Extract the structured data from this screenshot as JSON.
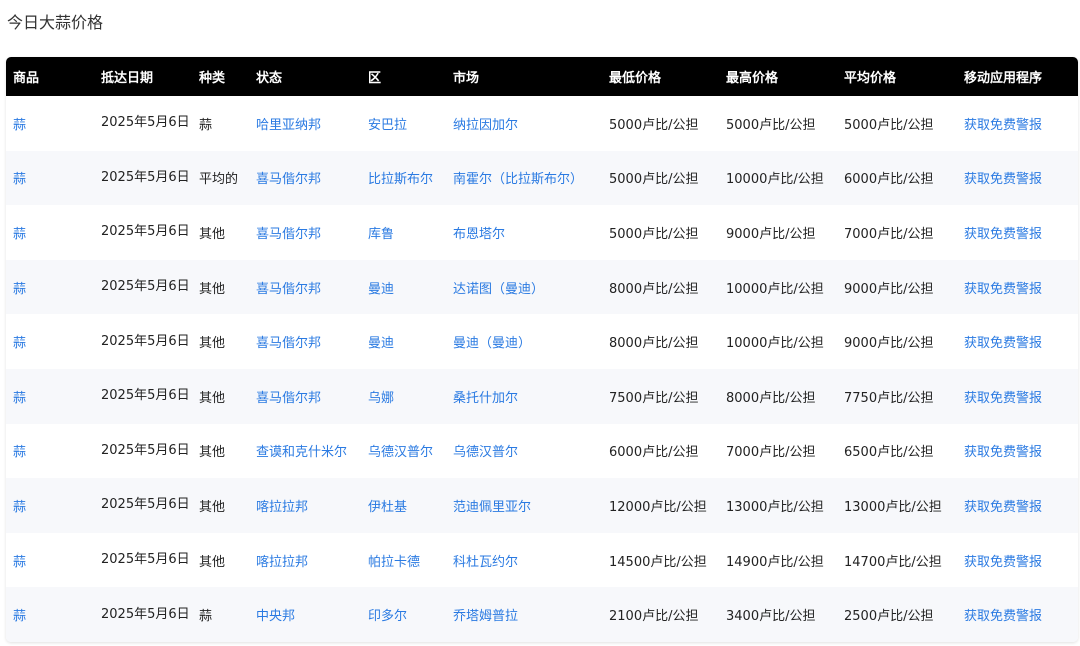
{
  "page": {
    "title": "今日大蒜价格"
  },
  "table": {
    "headers": [
      "商品",
      "抵达日期",
      "种类",
      "状态",
      "区",
      "市场",
      "最低价格",
      "最高价格",
      "平均价格",
      "移动应用程序"
    ],
    "rows": [
      {
        "commodity": "蒜",
        "date": "2025年5月6日",
        "variety": "蒜",
        "state": "哈里亚纳邦",
        "district": "安巴拉",
        "market": "纳拉因加尔",
        "min": "5000卢比/公担",
        "max": "5000卢比/公担",
        "avg": "5000卢比/公担",
        "app": "获取免费警报"
      },
      {
        "commodity": "蒜",
        "date": "2025年5月6日",
        "variety": "平均的",
        "state": "喜马偕尔邦",
        "district": "比拉斯布尔",
        "market": "南霍尔（比拉斯布尔）",
        "min": "5000卢比/公担",
        "max": "10000卢比/公担",
        "avg": "6000卢比/公担",
        "app": "获取免费警报"
      },
      {
        "commodity": "蒜",
        "date": "2025年5月6日",
        "variety": "其他",
        "state": "喜马偕尔邦",
        "district": "库鲁",
        "market": "布恩塔尔",
        "min": "5000卢比/公担",
        "max": "9000卢比/公担",
        "avg": "7000卢比/公担",
        "app": "获取免费警报"
      },
      {
        "commodity": "蒜",
        "date": "2025年5月6日",
        "variety": "其他",
        "state": "喜马偕尔邦",
        "district": "曼迪",
        "market": "达诺图（曼迪）",
        "min": "8000卢比/公担",
        "max": "10000卢比/公担",
        "avg": "9000卢比/公担",
        "app": "获取免费警报"
      },
      {
        "commodity": "蒜",
        "date": "2025年5月6日",
        "variety": "其他",
        "state": "喜马偕尔邦",
        "district": "曼迪",
        "market": "曼迪（曼迪）",
        "min": "8000卢比/公担",
        "max": "10000卢比/公担",
        "avg": "9000卢比/公担",
        "app": "获取免费警报"
      },
      {
        "commodity": "蒜",
        "date": "2025年5月6日",
        "variety": "其他",
        "state": "喜马偕尔邦",
        "district": "乌娜",
        "market": "桑托什加尔",
        "min": "7500卢比/公担",
        "max": "8000卢比/公担",
        "avg": "7750卢比/公担",
        "app": "获取免费警报"
      },
      {
        "commodity": "蒜",
        "date": "2025年5月6日",
        "variety": "其他",
        "state": "查谟和克什米尔",
        "district": "乌德汉普尔",
        "market": "乌德汉普尔",
        "min": "6000卢比/公担",
        "max": "7000卢比/公担",
        "avg": "6500卢比/公担",
        "app": "获取免费警报"
      },
      {
        "commodity": "蒜",
        "date": "2025年5月6日",
        "variety": "其他",
        "state": "喀拉拉邦",
        "district": "伊杜基",
        "market": "范迪佩里亚尔",
        "min": "12000卢比/公担",
        "max": "13000卢比/公担",
        "avg": "13000卢比/公担",
        "app": "获取免费警报"
      },
      {
        "commodity": "蒜",
        "date": "2025年5月6日",
        "variety": "其他",
        "state": "喀拉拉邦",
        "district": "帕拉卡德",
        "market": "科杜瓦约尔",
        "min": "14500卢比/公担",
        "max": "14900卢比/公担",
        "avg": "14700卢比/公担",
        "app": "获取免费警报"
      },
      {
        "commodity": "蒜",
        "date": "2025年5月6日",
        "variety": "蒜",
        "state": "中央邦",
        "district": "印多尔",
        "market": "乔塔姆普拉",
        "min": "2100卢比/公担",
        "max": "3400卢比/公担",
        "avg": "2500卢比/公担",
        "app": "获取免费警报"
      }
    ]
  },
  "colors": {
    "header_bg": "#000000",
    "link": "#2a7ae2",
    "row_alt": "#f7f8fb"
  }
}
